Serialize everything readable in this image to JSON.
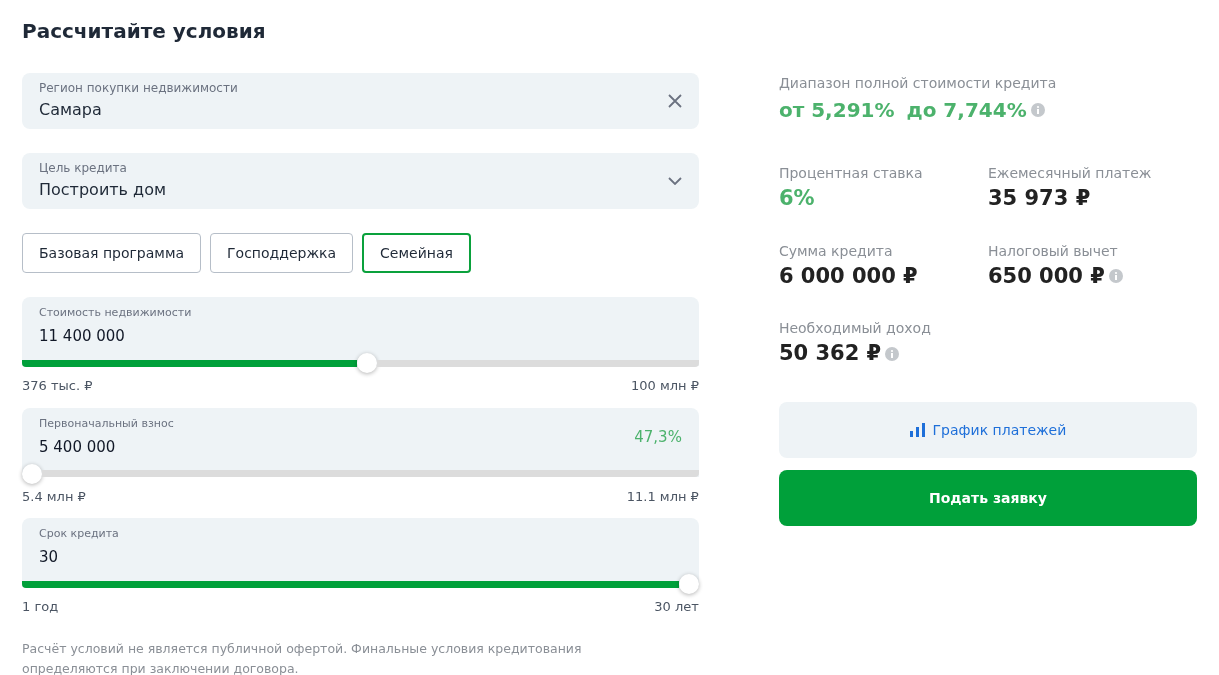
{
  "title": "Рассчитайте условия",
  "region": {
    "label": "Регион покупки недвижимости",
    "value": "Самара"
  },
  "purpose": {
    "label": "Цель кредита",
    "value": "Построить дом"
  },
  "programs": [
    {
      "label": "Базовая программа",
      "selected": false
    },
    {
      "label": "Господдержка",
      "selected": false
    },
    {
      "label": "Семейная",
      "selected": true
    }
  ],
  "sliders": [
    {
      "label": "Стоимость недвижимости",
      "value": "11 400 000",
      "level": 0.51,
      "min": "376 тыс. ₽",
      "max": "100 млн ₽"
    },
    {
      "label": "Первоначальный взнос",
      "value": "5 400 000",
      "share": "47,3%",
      "level": 0,
      "min": "5.4 млн ₽",
      "max": "11.1 млн ₽"
    },
    {
      "label": "Срок кредита",
      "value": "30",
      "level": 1,
      "min": "1 год",
      "max": "30 лет"
    }
  ],
  "disclaimer": "Расчёт условий не является публичной офертой. Финальные условия кредитования определяются при заключении договора.",
  "range": {
    "label": "Диапазон полной стоимости кредита",
    "from": "от 5,291%",
    "to": "до 7,744%",
    "info": true
  },
  "results": [
    {
      "label": "Процентная ставка",
      "value": "6%",
      "highlight": true,
      "info": false
    },
    {
      "label": "Ежемесячный платеж",
      "value": "35 973 ₽",
      "highlight": false,
      "info": false
    },
    {
      "label": "Сумма кредита",
      "value": "6 000 000 ₽",
      "highlight": false,
      "info": false
    },
    {
      "label": "Налоговый вычет",
      "value": "650 000 ₽",
      "highlight": false,
      "info": true
    },
    {
      "label": "Необходимый доход",
      "value": "50 362 ₽",
      "highlight": false,
      "info": true
    }
  ],
  "schedule_button": "График платежей",
  "apply_button": "Подать заявку"
}
